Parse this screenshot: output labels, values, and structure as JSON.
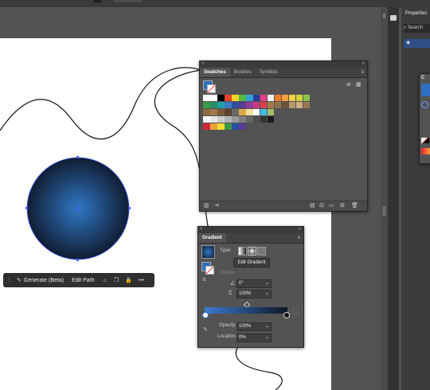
{
  "properties_panel": {
    "title": "Properties",
    "search_placeholder": "Search"
  },
  "swatches_panel": {
    "tabs": [
      "Swatches",
      "Brushes",
      "Symbols"
    ],
    "swatch_rows": [
      [
        "#ffffff",
        "#ffffff",
        "#000000",
        "#e8452c",
        "#f3d323",
        "#55b848",
        "#33a0d8",
        "#2b3b97",
        "#e63b8a",
        "#f2f2f2",
        "#ef7c2a",
        "#f1a23d",
        "#f5cf4a",
        "#cfd63a",
        "#8bc34a"
      ],
      [
        "#3a9a48",
        "#2a8c6a",
        "#1f9fa7",
        "#3b7cc4",
        "#2f4fa1",
        "#5a3a94",
        "#8f3d98",
        "#c93b83",
        "#d8404a",
        "#a87a4a",
        "#8f7250",
        "#6c5640",
        "#b89a6a",
        "#d0b080",
        "#9a7a56"
      ],
      [
        "#8e6b46",
        "#a07a4e",
        "#7a5a3a",
        "#5e432c",
        "#6a6a6a",
        "#dba949",
        "#efe3a0",
        "#ffffff",
        "#40c0e0",
        "#9fbf6a"
      ],
      [
        "#ffffff",
        "#e5e5e5",
        "#cccccc",
        "#b3b3b3",
        "#999999",
        "#808080",
        "#666666",
        "#4d4d4d",
        "#333333",
        "#1a1a1a"
      ],
      [
        "#d6263a",
        "#e9a33a",
        "#f3de32",
        "#3a9a48",
        "#2b4ea0",
        "#5a3a94"
      ]
    ]
  },
  "gradient_panel": {
    "tab": "Gradient",
    "type_label": "Type:",
    "edit_button": "Edit Gradient",
    "stroke_label": "Stroke:",
    "angle_value": "0°",
    "aspect_value": "100%",
    "opacity_label": "Opacity:",
    "opacity_value": "100%",
    "location_label": "Location:",
    "location_value": "0%",
    "colors": {
      "start": "#3b7ad0",
      "end": "#0d1724"
    }
  },
  "context_toolbar": {
    "generate_label": "Generate (Beta)",
    "edit_path_label": "Edit Path"
  },
  "collapsed_panel": {
    "label": "C"
  },
  "colors": {
    "circle_center": "#2f78c4",
    "circle_edge": "#111d33",
    "selection": "#3f5fff"
  }
}
